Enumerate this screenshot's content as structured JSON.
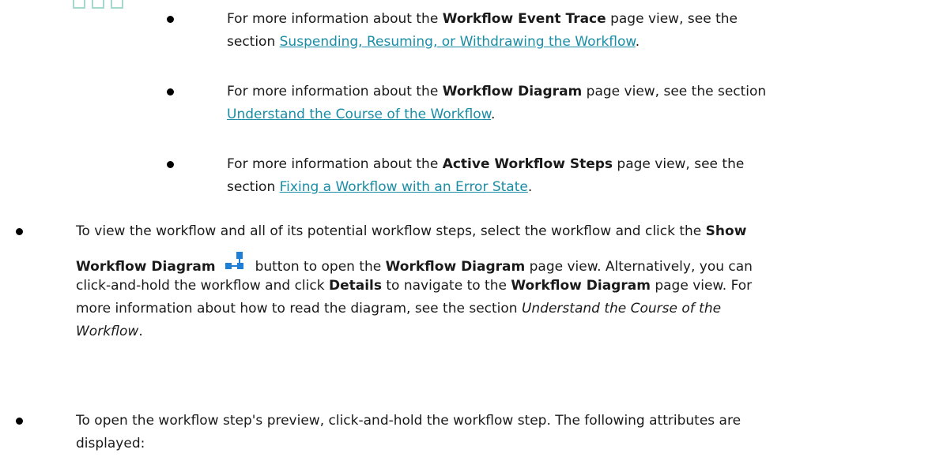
{
  "items": [
    {
      "pre": "For more information about the ",
      "bold": "Workflow Event Trace",
      "mid": " page view, see the",
      "line2_pre": "section ",
      "link": "Suspending, Resuming, or Withdrawing the Workflow",
      "post": "."
    },
    {
      "pre": "For more information about the ",
      "bold": "Workflow Diagram",
      "mid": " page view, see the section",
      "line2_pre": "",
      "link": "Understand the Course of the Workflow",
      "post": "."
    },
    {
      "pre": "For more information about the ",
      "bold": "Active Workflow Steps",
      "mid": " page view, see the",
      "line2_pre": "section ",
      "link": "Fixing a Workflow with an Error State",
      "post": "."
    }
  ],
  "outer": {
    "item1": {
      "a": "To view the workflow and all of its potential workflow steps, select the workflow and click the ",
      "b": "Show",
      "c": "Workflow Diagram",
      "d": "button to open the ",
      "e": "Workflow Diagram",
      "f": " page view. Alternatively, you can",
      "g": "click-and-hold the workflow and click ",
      "h": "Details",
      "i": " to navigate to the ",
      "j": "Workflow Diagram",
      "k": " page view. For",
      "l": "more information about how to read the diagram, see the section ",
      "m": "Understand the Course of the",
      "n": "Workflow",
      "o": "."
    },
    "item2": {
      "line1": "To open the workflow step's preview, click-and-hold the workflow step. The following attributes are",
      "line2": "displayed:"
    }
  },
  "icons": {
    "top": "tab-icon",
    "diagram": "workflow-diagram-icon",
    "accent": "#1a8da6",
    "icon_blue": "#1f7fd6"
  }
}
